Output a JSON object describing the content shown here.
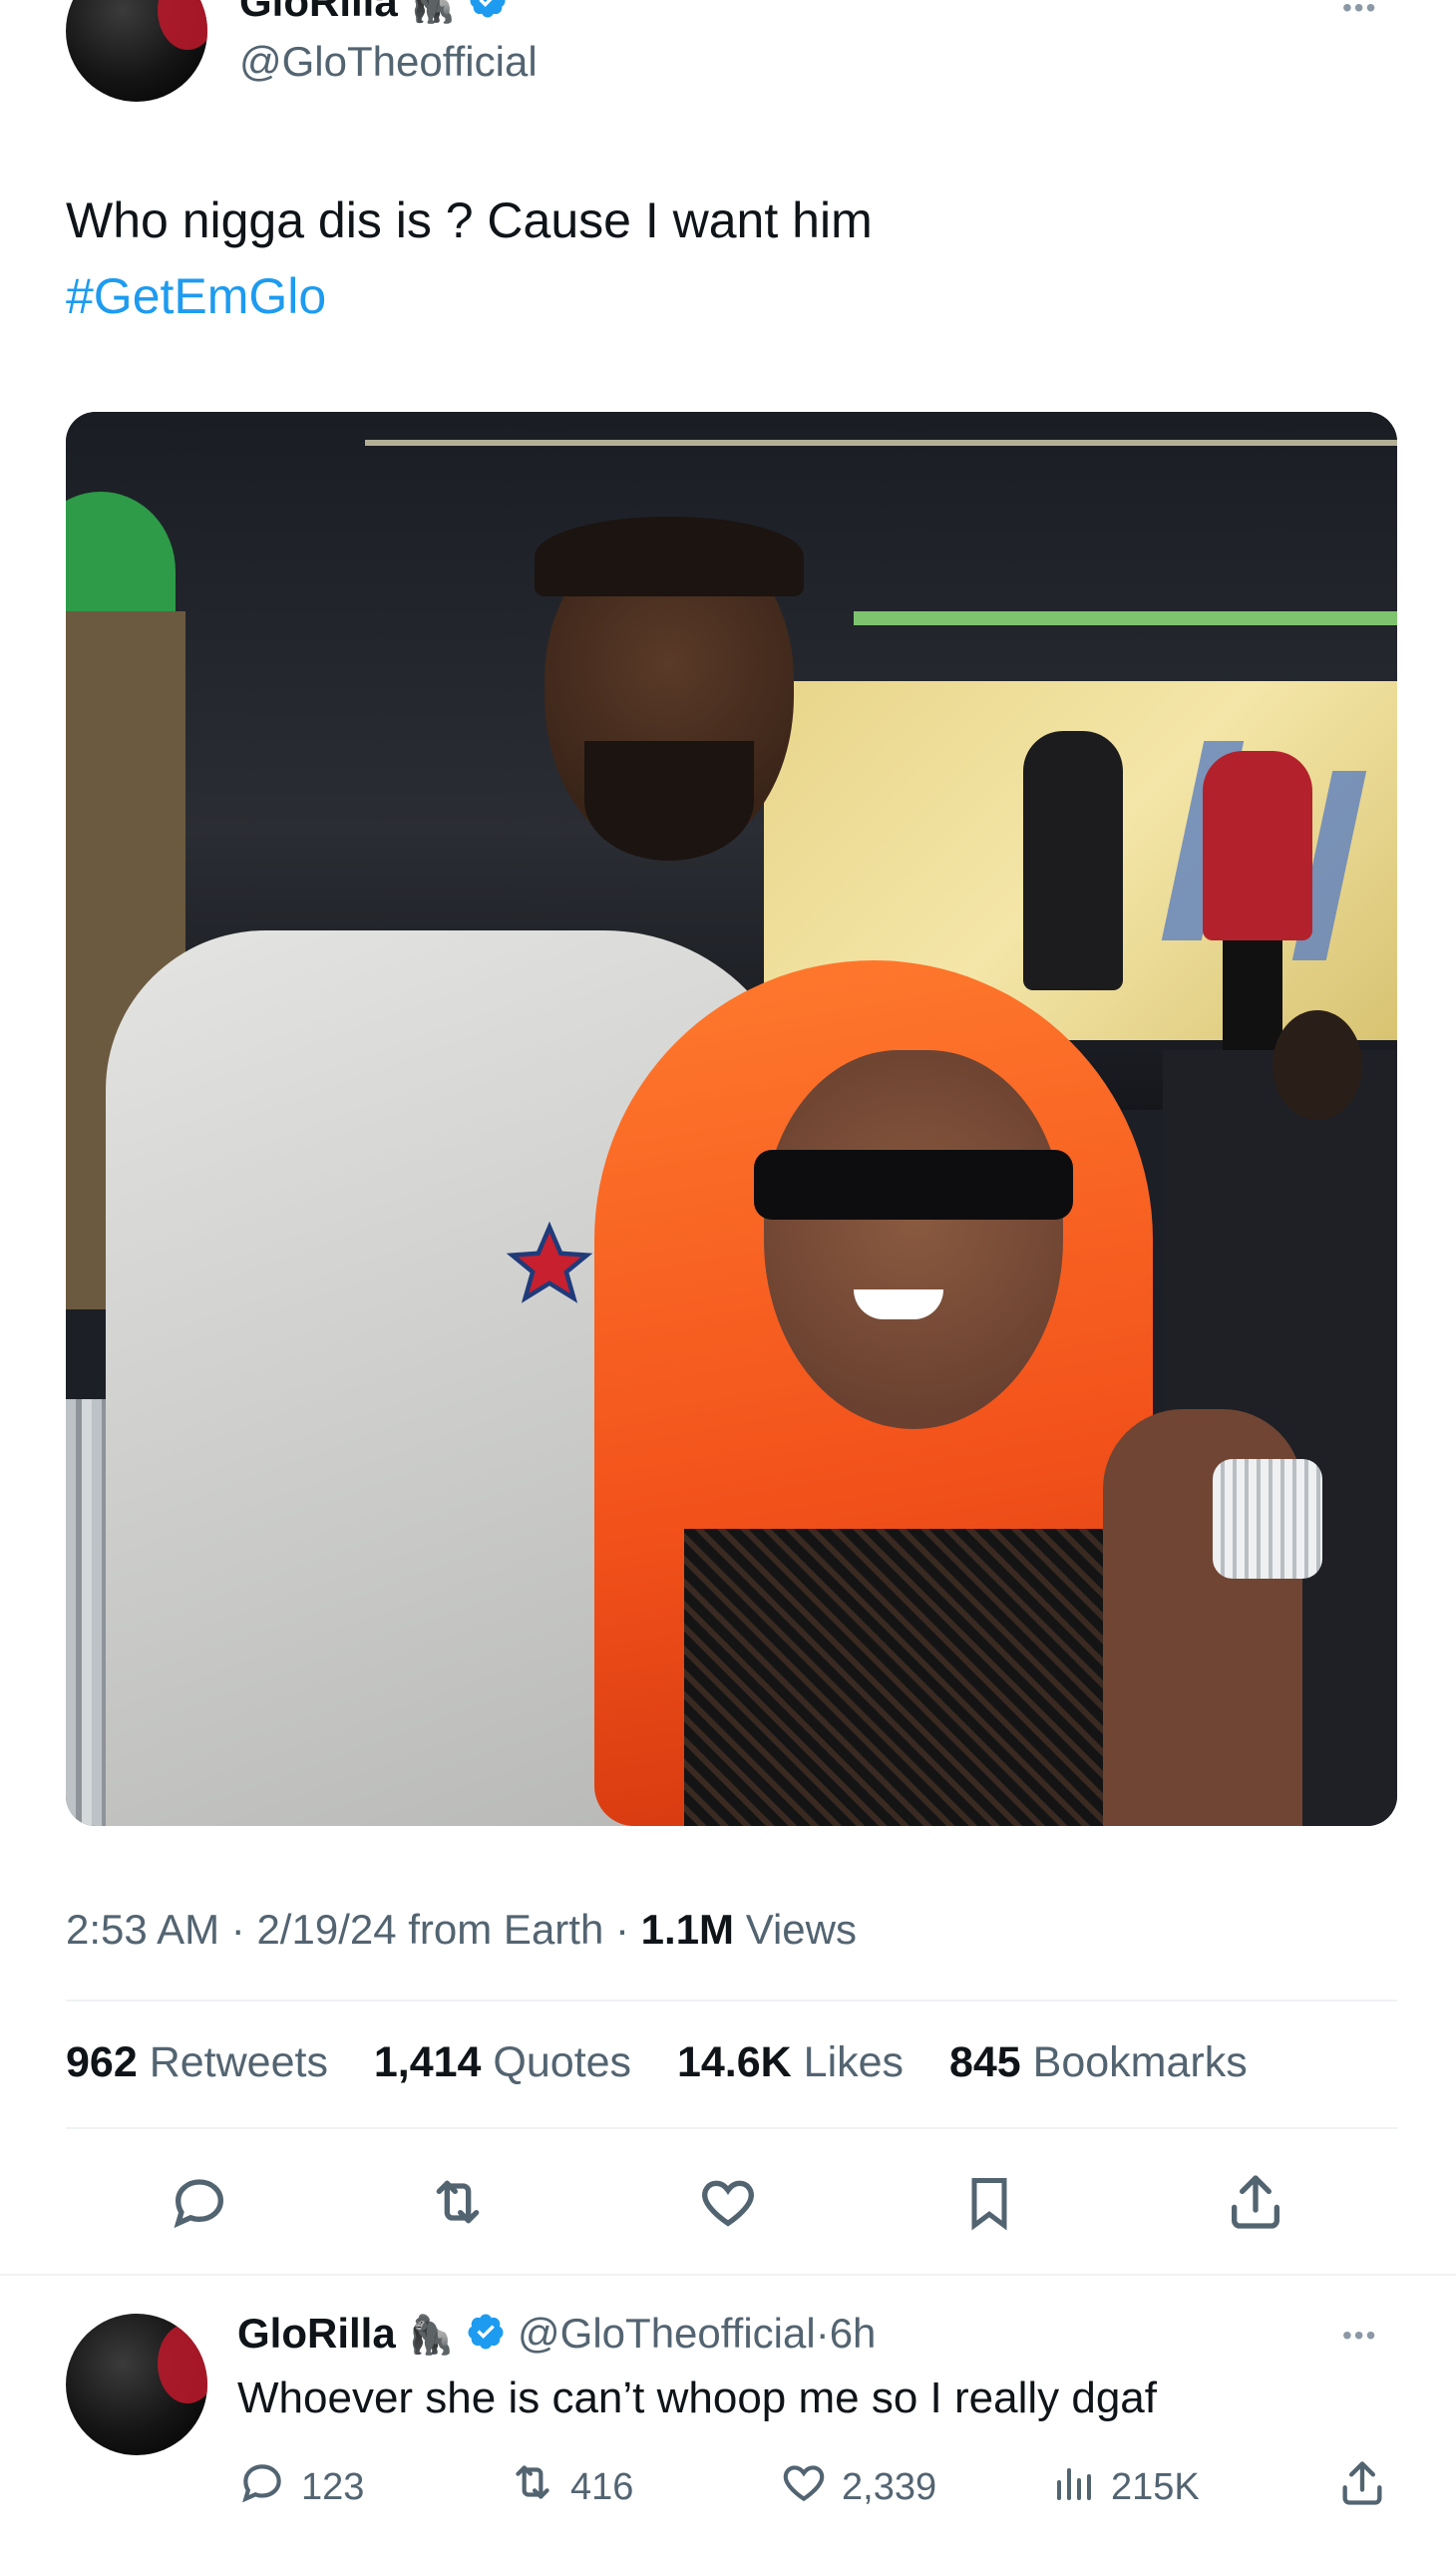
{
  "tweet": {
    "author_name": "GloRilla",
    "author_handle": "@GloTheofficial",
    "text": "Who nigga dis is ? Cause I want him",
    "hashtag": "#GetEmGlo",
    "meta": {
      "time": "2:53 AM",
      "separator1": "·",
      "date": "2/19/24",
      "source": "from Earth",
      "separator2": "·",
      "views_count": "1.1M",
      "views_label": "Views"
    },
    "stats": [
      {
        "count": "962",
        "label": "Retweets"
      },
      {
        "count": "1,414",
        "label": "Quotes"
      },
      {
        "count": "14.6K",
        "label": "Likes"
      },
      {
        "count": "845",
        "label": "Bookmarks"
      }
    ],
    "actions": [
      "reply-icon",
      "retweet-icon",
      "like-icon",
      "bookmark-icon",
      "share-icon"
    ]
  },
  "reply": {
    "author_name": "GloRilla",
    "author_handle": "@GloTheofficial",
    "separator": "·",
    "time": "6h",
    "text": "Whoever she is can’t whoop me so I really dgaf",
    "replies": "123",
    "retweets": "416",
    "likes": "2,339",
    "views": "215K"
  },
  "colors": {
    "accent": "#1d9bf0",
    "muted": "#536471",
    "divider": "#eff3f4"
  }
}
